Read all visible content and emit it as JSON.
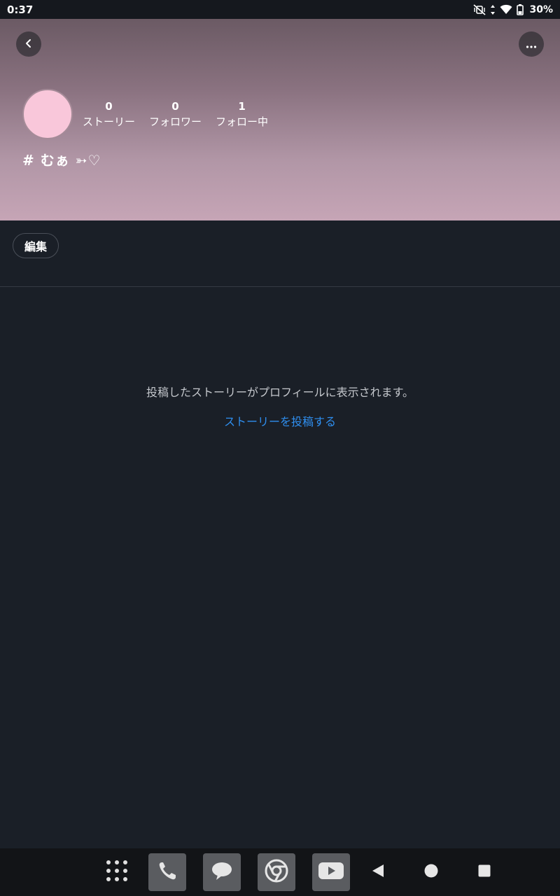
{
  "status_bar": {
    "time": "0:37",
    "battery_percent": "30%",
    "icons": [
      "mute-vibrate-icon",
      "data-arrows-icon",
      "wifi-icon",
      "battery-icon"
    ]
  },
  "header": {
    "back_icon": "chevron-left-icon",
    "more_icon": "more-horizontal-icon",
    "avatar_color": "#f9c7da",
    "stats": [
      {
        "count": "0",
        "label": "ストーリー"
      },
      {
        "count": "0",
        "label": "フォロワー"
      },
      {
        "count": "1",
        "label": "フォロー中"
      }
    ],
    "profile_name": "# むぁ ➳♡"
  },
  "actions": {
    "edit_label": "編集"
  },
  "empty_state": {
    "message": "投稿したストーリーがプロフィールに表示されます。",
    "link_label": "ストーリーを投稿する",
    "link_color": "#2f8ff0"
  },
  "nav_bar": {
    "apps": [
      "apps-grid-icon",
      "phone-icon",
      "messages-icon",
      "chrome-icon",
      "youtube-icon"
    ],
    "system_buttons": [
      "back-triangle-icon",
      "home-circle-icon",
      "recents-square-icon"
    ]
  }
}
